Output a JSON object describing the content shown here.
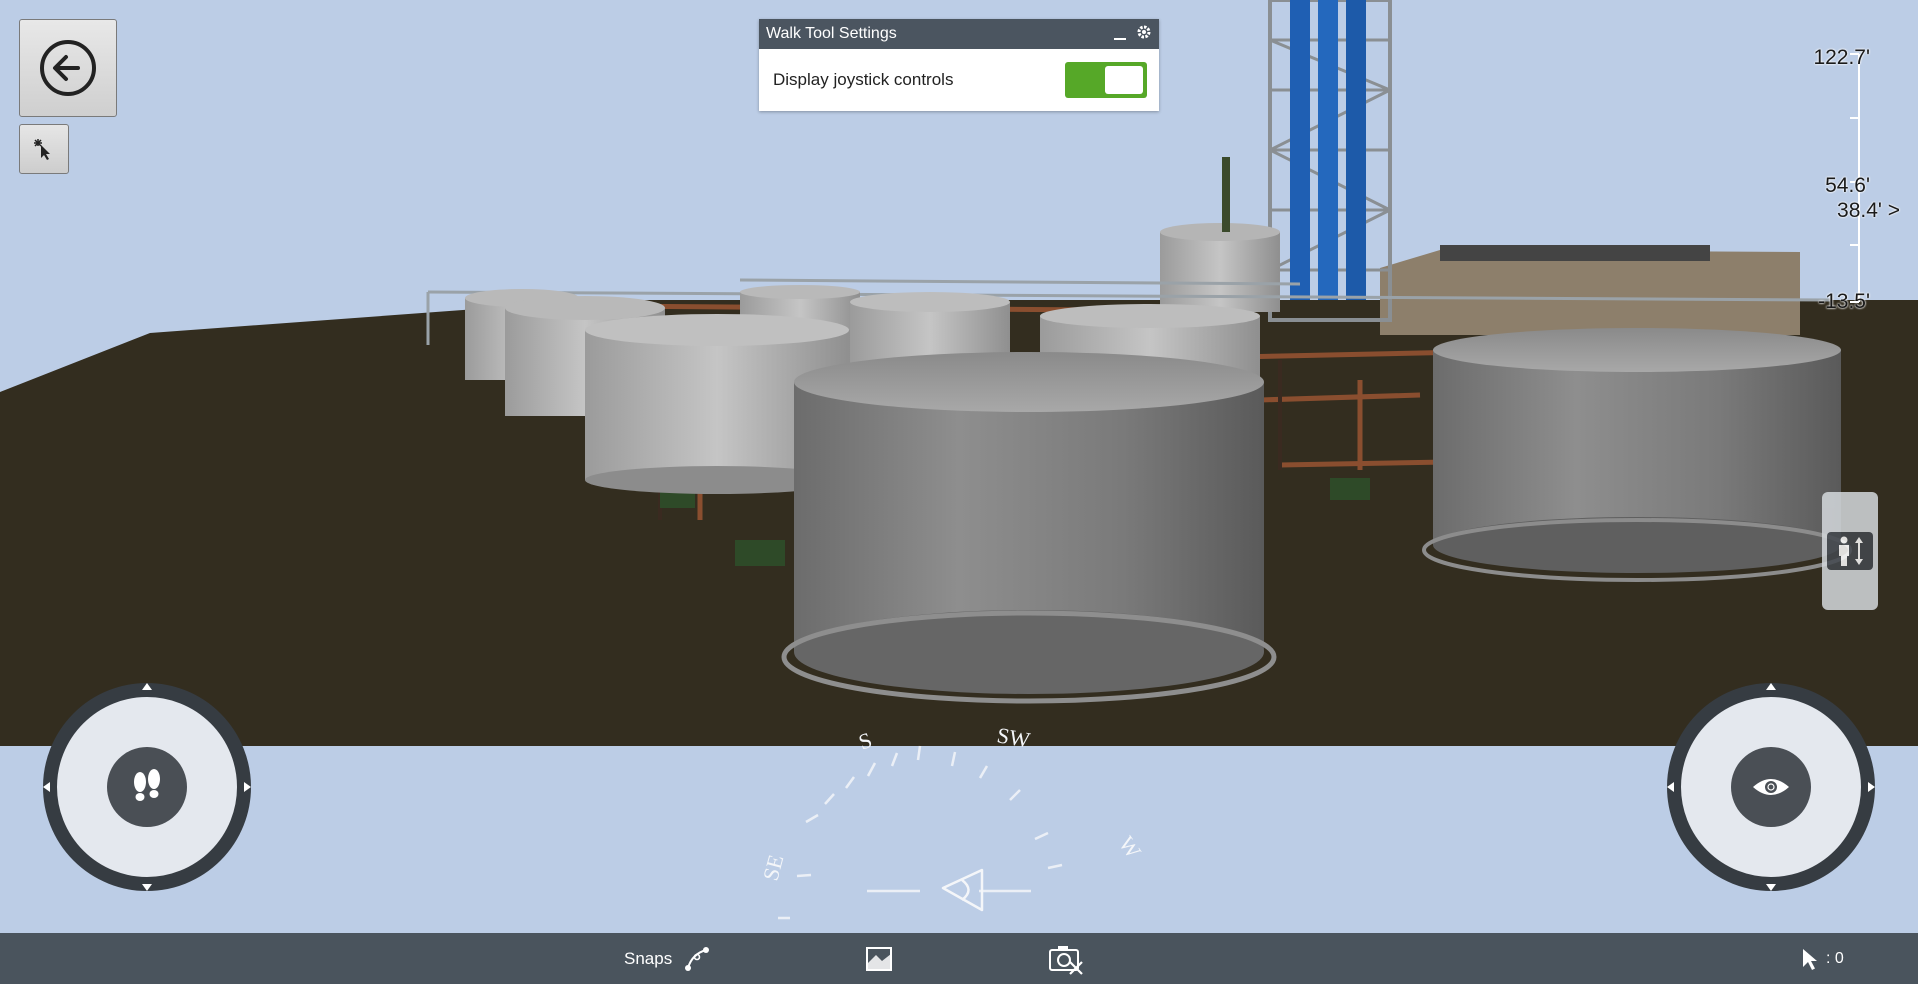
{
  "settings_panel": {
    "title": "Walk Tool Settings",
    "option_label": "Display joystick controls",
    "toggle_on": true,
    "toggle_color": "#56a828"
  },
  "elevation_scale": {
    "labels": [
      "122.7'",
      "54.6'",
      "38.4' >",
      "-13.5'"
    ]
  },
  "compass": {
    "labels": [
      "S",
      "SW",
      "SE",
      "W"
    ]
  },
  "bottom_bar": {
    "snaps_label": "Snaps",
    "pointer_count": ": 0"
  },
  "icons": {
    "back": "back-arrow-icon",
    "select": "select-pointer-icon",
    "walk": "footprints-icon",
    "look": "eye-icon",
    "height": "person-height-icon",
    "snaps": "snap-curve-icon",
    "view": "view-icon",
    "screenshot": "camera-icon",
    "pointer": "cursor-icon"
  }
}
